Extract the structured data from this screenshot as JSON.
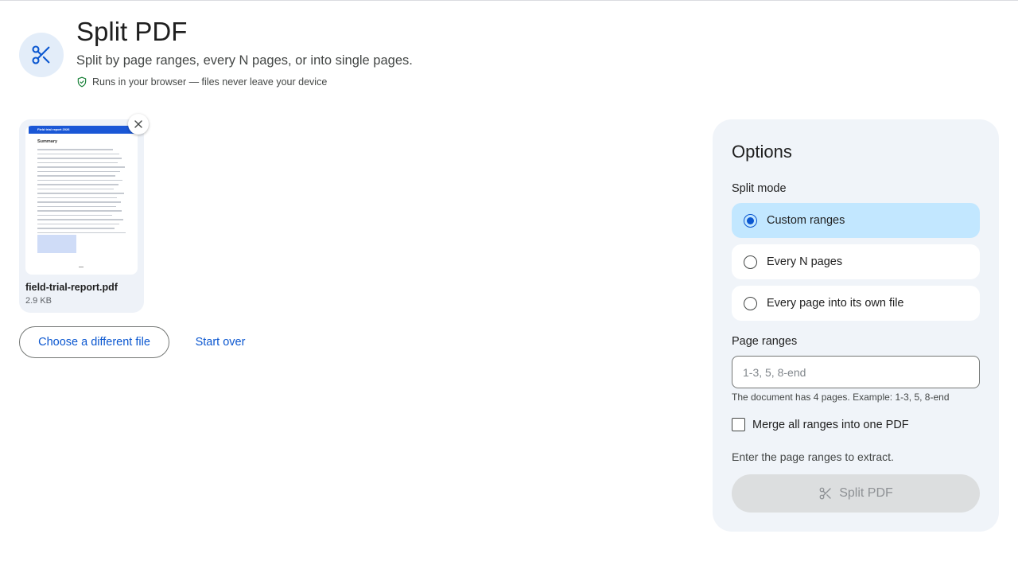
{
  "header": {
    "icon": "scissors-icon",
    "title": "Split PDF",
    "subtitle": "Split by page ranges, every N pages, or into single pages.",
    "privacy_icon": "shield-check-icon",
    "privacy_note": "Runs in your browser — files never leave your device"
  },
  "file": {
    "thumbnail_title": "Field trial report 2026",
    "thumbnail_heading": "Summary",
    "name": "field-trial-report.pdf",
    "size": "2.9 KB",
    "remove_icon": "close-icon"
  },
  "actions": {
    "choose_label": "Choose a different file",
    "start_over_label": "Start over"
  },
  "options": {
    "title": "Options",
    "split_mode_label": "Split mode",
    "modes": [
      {
        "label": "Custom ranges",
        "selected": true
      },
      {
        "label": "Every N pages",
        "selected": false
      },
      {
        "label": "Every page into its own file",
        "selected": false
      }
    ],
    "page_ranges_label": "Page ranges",
    "page_ranges_value": "",
    "page_ranges_placeholder": "1-3, 5, 8-end",
    "hint": "The document has 4 pages. Example: 1-3, 5, 8-end",
    "merge_label": "Merge all ranges into one PDF",
    "merge_checked": false,
    "status": "Enter the page ranges to extract.",
    "submit_label": "Split PDF",
    "submit_icon": "scissors-icon",
    "submit_disabled": true
  },
  "colors": {
    "accent": "#0b57d0",
    "selected_option": "#c2e7ff",
    "panel": "#f0f4f9",
    "disabled_button": "#dcdedf"
  }
}
